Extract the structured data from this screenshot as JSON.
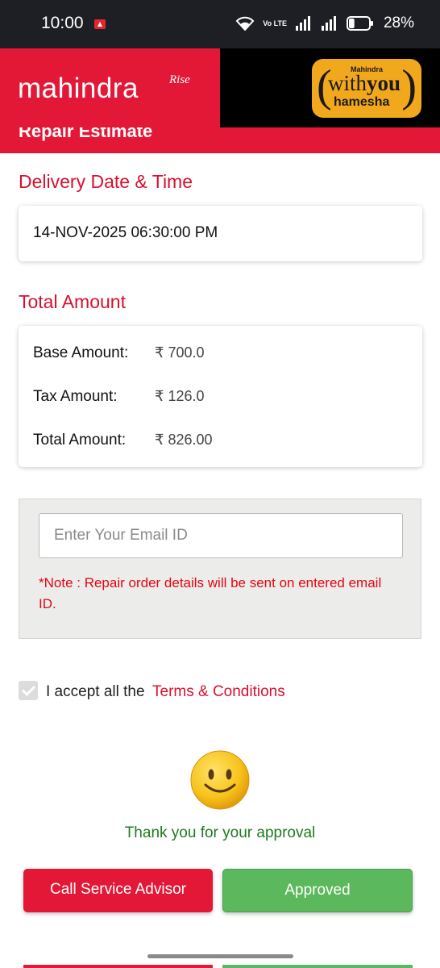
{
  "status_bar": {
    "time": "10:00",
    "network_label": "Vo LTE",
    "battery_percent": "28%",
    "battery_level": 0.28
  },
  "header": {
    "brand": "mahindra",
    "brand_suffix": "Rise",
    "tagline_top": "Mahindra",
    "tagline_with": "with",
    "tagline_you": "you",
    "tagline_bottom": "hamesha"
  },
  "page": {
    "section_title": "Repair Estimate"
  },
  "delivery": {
    "heading": "Delivery Date & Time",
    "value": "14-NOV-2025 06:30:00 PM"
  },
  "amounts": {
    "heading": "Total Amount",
    "rows": [
      {
        "label": "Base Amount:",
        "value": "₹ 700.0"
      },
      {
        "label": "Tax Amount:",
        "value": "₹ 126.0"
      },
      {
        "label": "Total Amount:",
        "value": "₹ 826.00"
      }
    ]
  },
  "email": {
    "placeholder": "Enter Your Email ID",
    "note": "*Note : Repair order details will be sent on entered email ID."
  },
  "terms": {
    "prefix": "I accept all the",
    "link": "Terms & Conditions",
    "checked": true
  },
  "confirmation": {
    "message": "Thank you for your approval"
  },
  "actions": {
    "call_label": "Call Service Advisor",
    "approved_label": "Approved"
  },
  "colors": {
    "brand_red": "#e31837",
    "approved_green": "#5cb85c",
    "heading_red": "#d8102d",
    "thanks_green": "#1e7b1e"
  }
}
